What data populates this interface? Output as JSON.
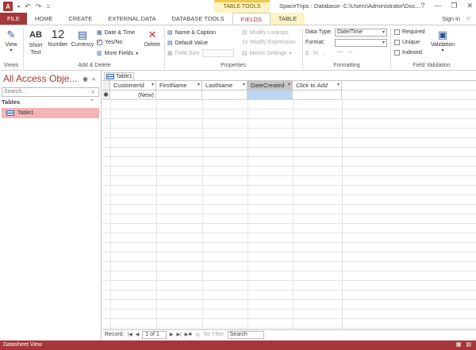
{
  "qat": {
    "logo": "A",
    "undo": "↶",
    "redo": "↷",
    "customize": "="
  },
  "title_bar": {
    "context_group": "TABLE TOOLS",
    "title": "SpaceTrips : Database- C:\\Users\\Administrator\\Doc...",
    "help": "?",
    "minimize": "—",
    "restore": "❐",
    "close": "✕"
  },
  "tabs": [
    "FILE",
    "HOME",
    "CREATE",
    "EXTERNAL DATA",
    "DATABASE TOOLS",
    "FIELDS",
    "TABLE"
  ],
  "active_tab": "FIELDS",
  "signin": "Sign in",
  "ribbon": {
    "views": {
      "view_label": "View",
      "group": "Views"
    },
    "add_delete": {
      "group": "Add & Delete",
      "short_text": "Short\nText",
      "number": "Number",
      "currency": "Currency",
      "date_time": "Date & Time",
      "yes_no": "Yes/No",
      "more_fields": "More Fields",
      "delete": "Delete",
      "ab_glyph": "AB",
      "number_glyph": "12"
    },
    "properties": {
      "group": "Properties",
      "name_caption": "Name & Caption",
      "default_value": "Default Value",
      "field_size": "Field Size",
      "modify_lookups": "Modify Lookups",
      "modify_expression": "Modify Expression",
      "memo_settings": "Memo Settings"
    },
    "formatting": {
      "group": "Formatting",
      "data_type_label": "Data Type:",
      "data_type_value": "Date/Time",
      "format_label": "Format:",
      "format_value": "",
      "symbols": "$  %  ,    .00  .00"
    },
    "validation": {
      "group": "Field Validation",
      "required": "Required",
      "unique": "Unique",
      "indexed": "Indexed",
      "validation": "Validation"
    }
  },
  "nav": {
    "title": "All Access Obje...",
    "search_placeholder": "Search...",
    "section": "Tables",
    "items": [
      {
        "label": "Table1"
      }
    ]
  },
  "document": {
    "tab_label": "Table1",
    "columns": [
      "CustomerId",
      "FirstName",
      "LastName",
      "DateCreated",
      "Click to Add"
    ],
    "new_row_marker": "✱",
    "new_row_label": "(New)"
  },
  "record_nav": {
    "label": "Record:",
    "position": "1 of 1",
    "filter": "No Filter",
    "search": "Search"
  },
  "status": {
    "text": "Datasheet View"
  },
  "colors": {
    "accent": "#a4373a",
    "context": "#fdf3c2",
    "selection": "#bcd6f1"
  }
}
